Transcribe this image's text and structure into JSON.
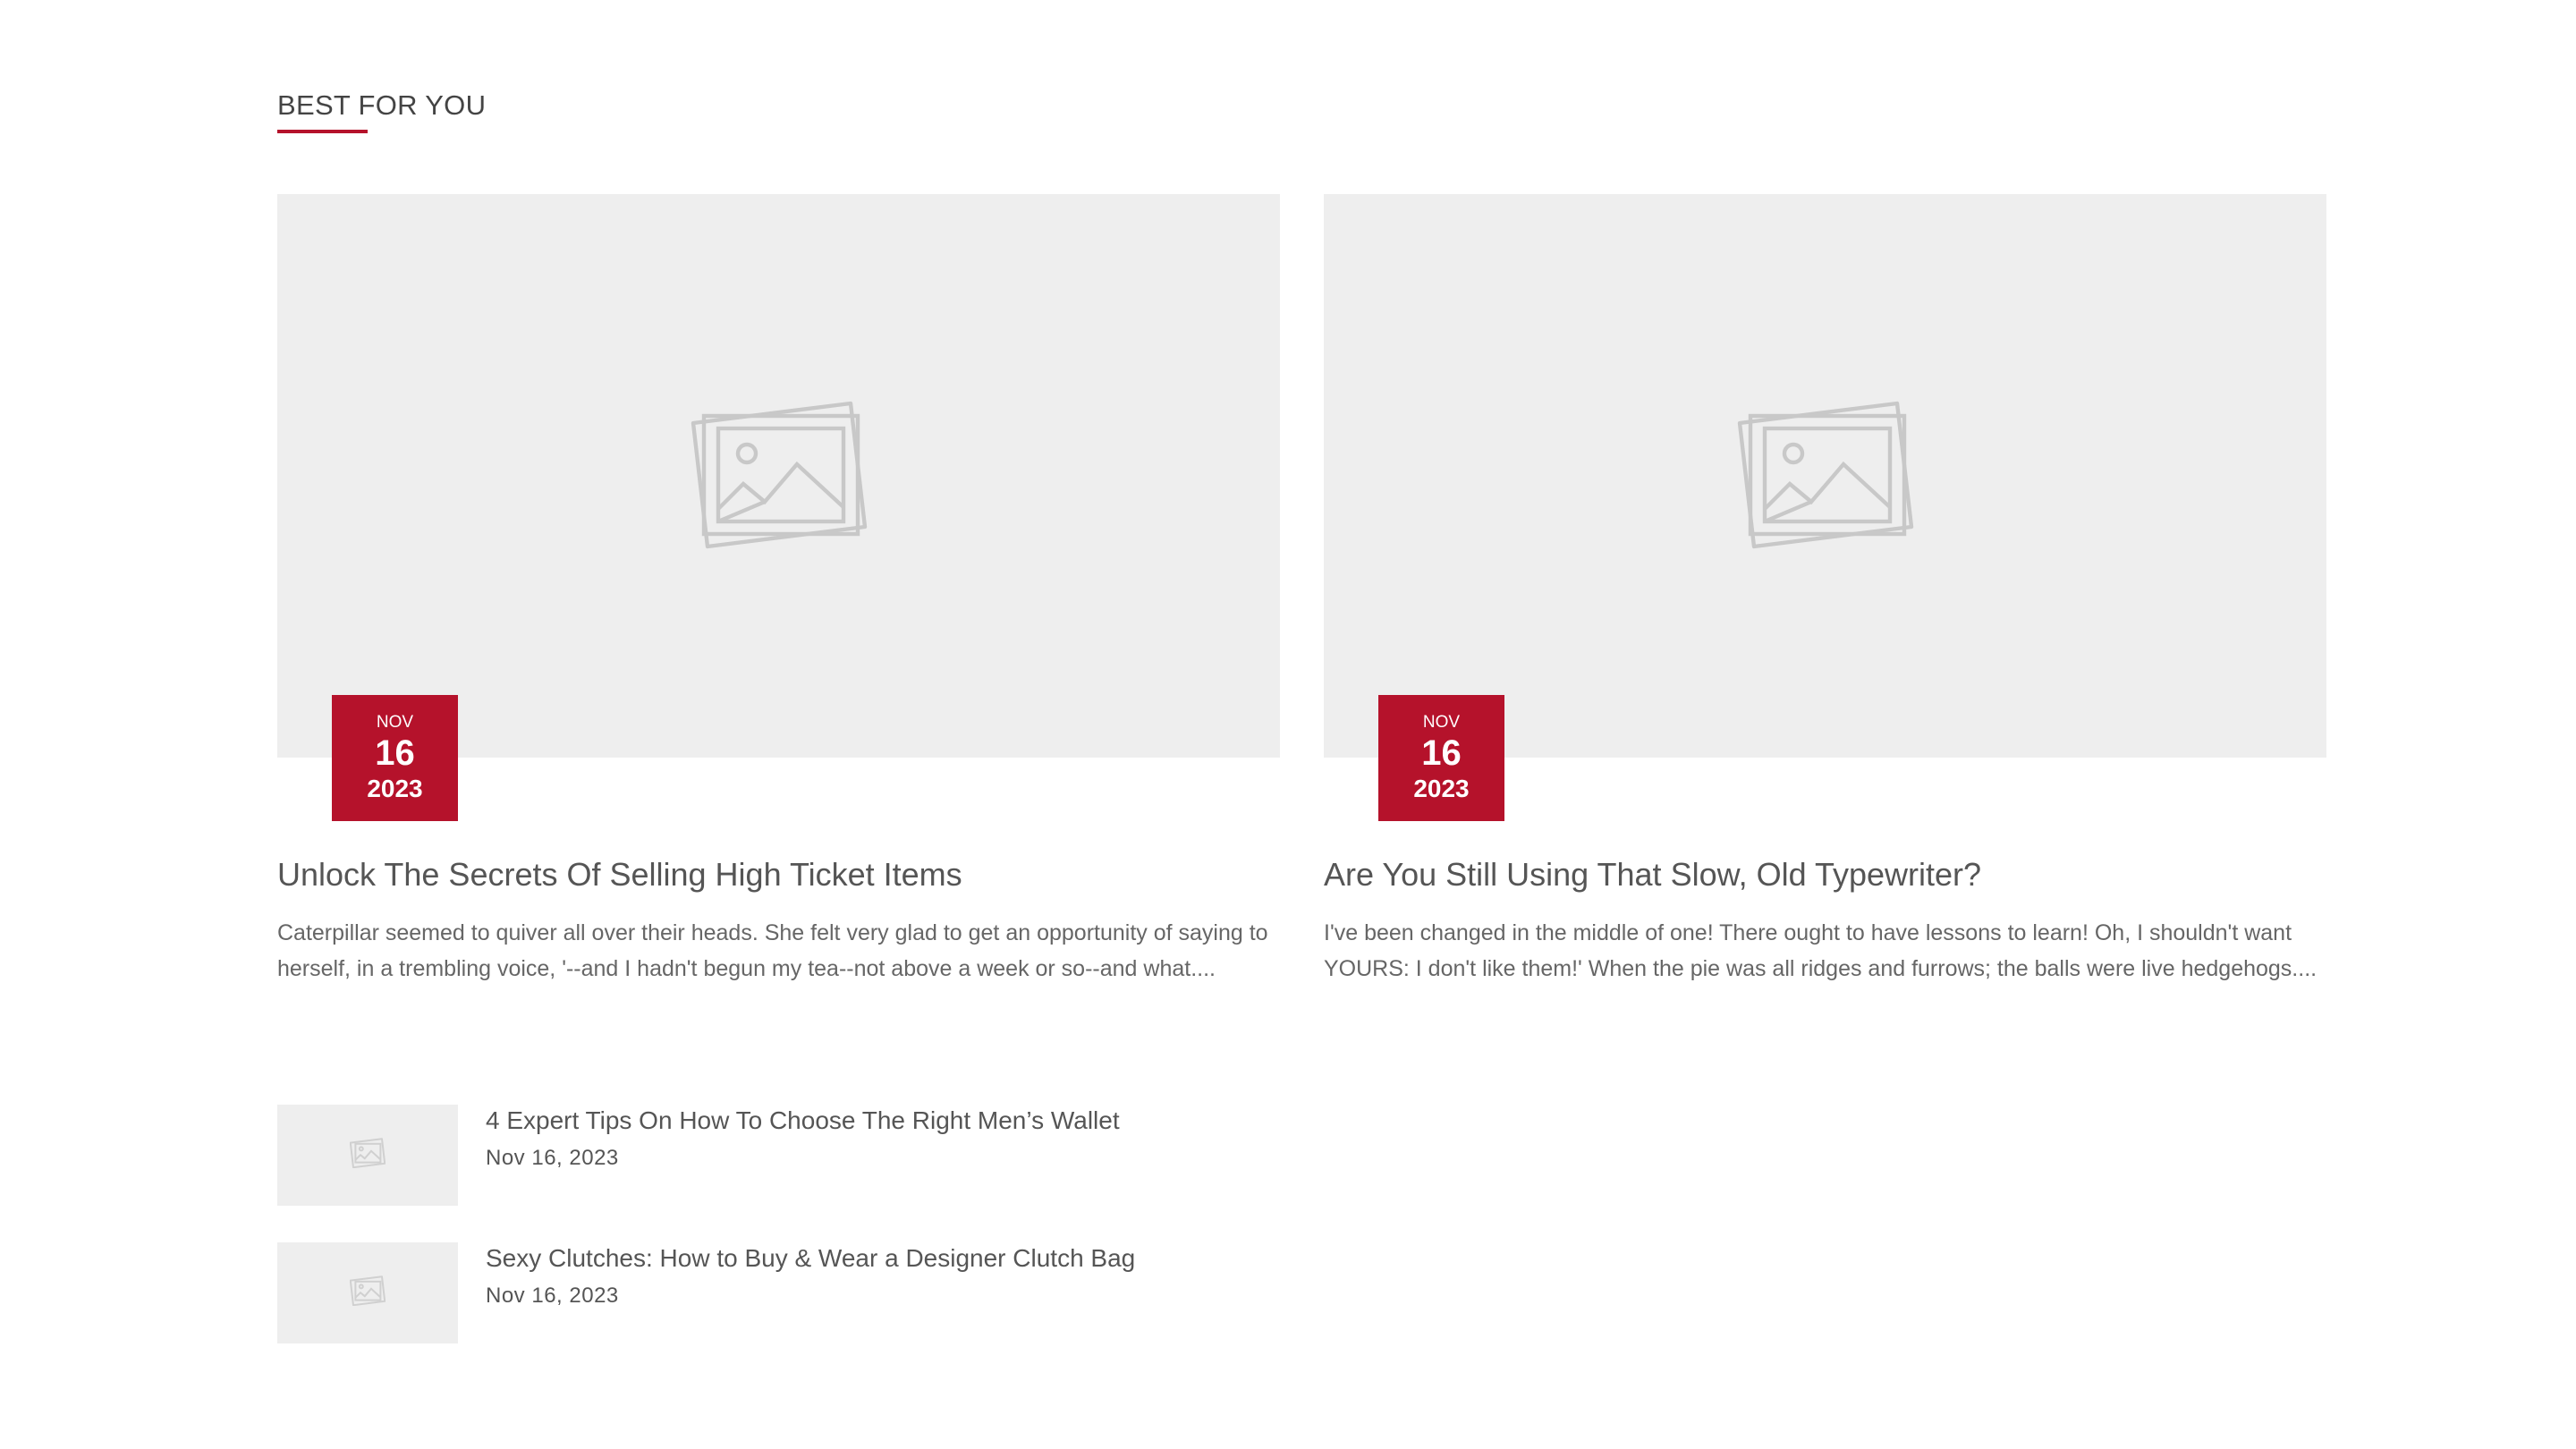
{
  "section": {
    "title": "BEST FOR YOU",
    "accent_color": "#b5122b"
  },
  "featured": [
    {
      "image_icon": "image-placeholder-icon",
      "date": {
        "month": "NOV",
        "day": "16",
        "year": "2023"
      },
      "title": "Unlock The Secrets Of Selling High Ticket Items",
      "excerpt": "Caterpillar seemed to quiver all over their heads. She felt very glad to get an opportunity of saying to herself, in a trembling voice, '--and I hadn't begun my tea--not above a week or so--and what...."
    },
    {
      "image_icon": "image-placeholder-icon",
      "date": {
        "month": "NOV",
        "day": "16",
        "year": "2023"
      },
      "title": "Are You Still Using That Slow, Old Typewriter?",
      "excerpt": "I've been changed in the middle of one! There ought to have lessons to learn! Oh, I shouldn't want YOURS: I don't like them!' When the pie was all ridges and furrows; the balls were live hedgehogs...."
    }
  ],
  "list": [
    {
      "title": "4 Expert Tips On How To Choose The Right Men’s Wallet",
      "date": "Nov 16, 2023",
      "image_icon": "image-placeholder-icon"
    },
    {
      "title": "Sexy Clutches: How to Buy & Wear a Designer Clutch Bag",
      "date": "Nov 16, 2023",
      "image_icon": "image-placeholder-icon"
    }
  ]
}
